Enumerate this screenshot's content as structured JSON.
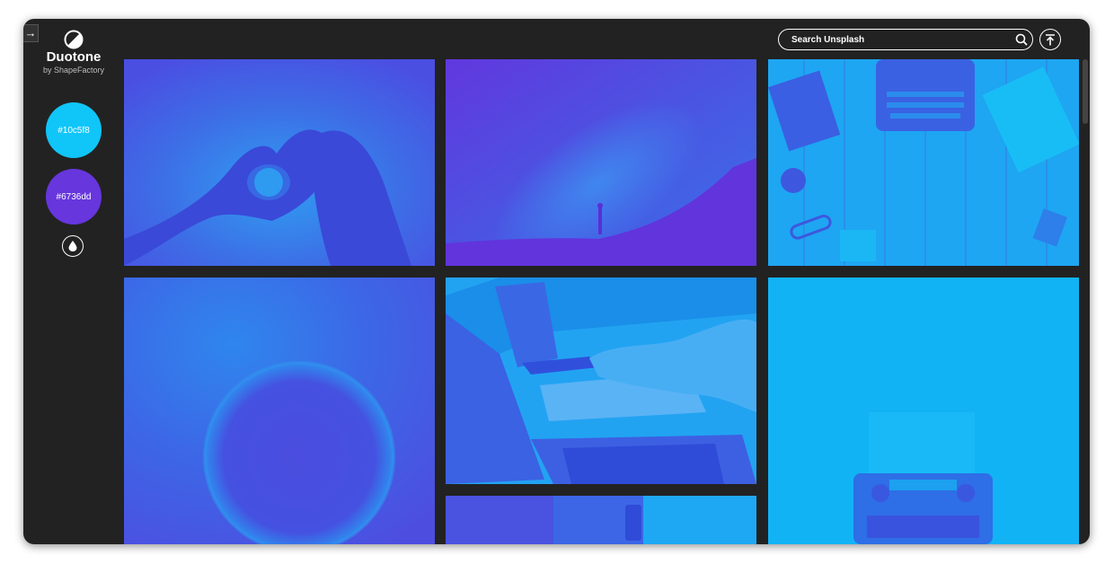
{
  "app": {
    "title": "Duotone",
    "subtitle": "by ShapeFactory"
  },
  "sidebar": {
    "collapse_icon": "arrow-right-icon",
    "swatches": [
      {
        "label": "#10c5f8",
        "color": "#10c5f8"
      },
      {
        "label": "#6736dd",
        "color": "#6736dd"
      }
    ],
    "invert_icon": "drop-icon"
  },
  "search": {
    "placeholder": "Search Unsplash",
    "value": "",
    "icon": "search-icon"
  },
  "header": {
    "scroll_top_icon": "arrow-up-to-line-icon"
  },
  "gallery": {
    "photos": [
      {
        "subject": "heart-hands"
      },
      {
        "subject": "milky-way"
      },
      {
        "subject": "typewriter-desk"
      },
      {
        "subject": "nebula"
      },
      {
        "subject": "laptop-writing"
      },
      {
        "subject": "typewriter-paper"
      },
      {
        "subject": "hand-watch"
      }
    ]
  }
}
